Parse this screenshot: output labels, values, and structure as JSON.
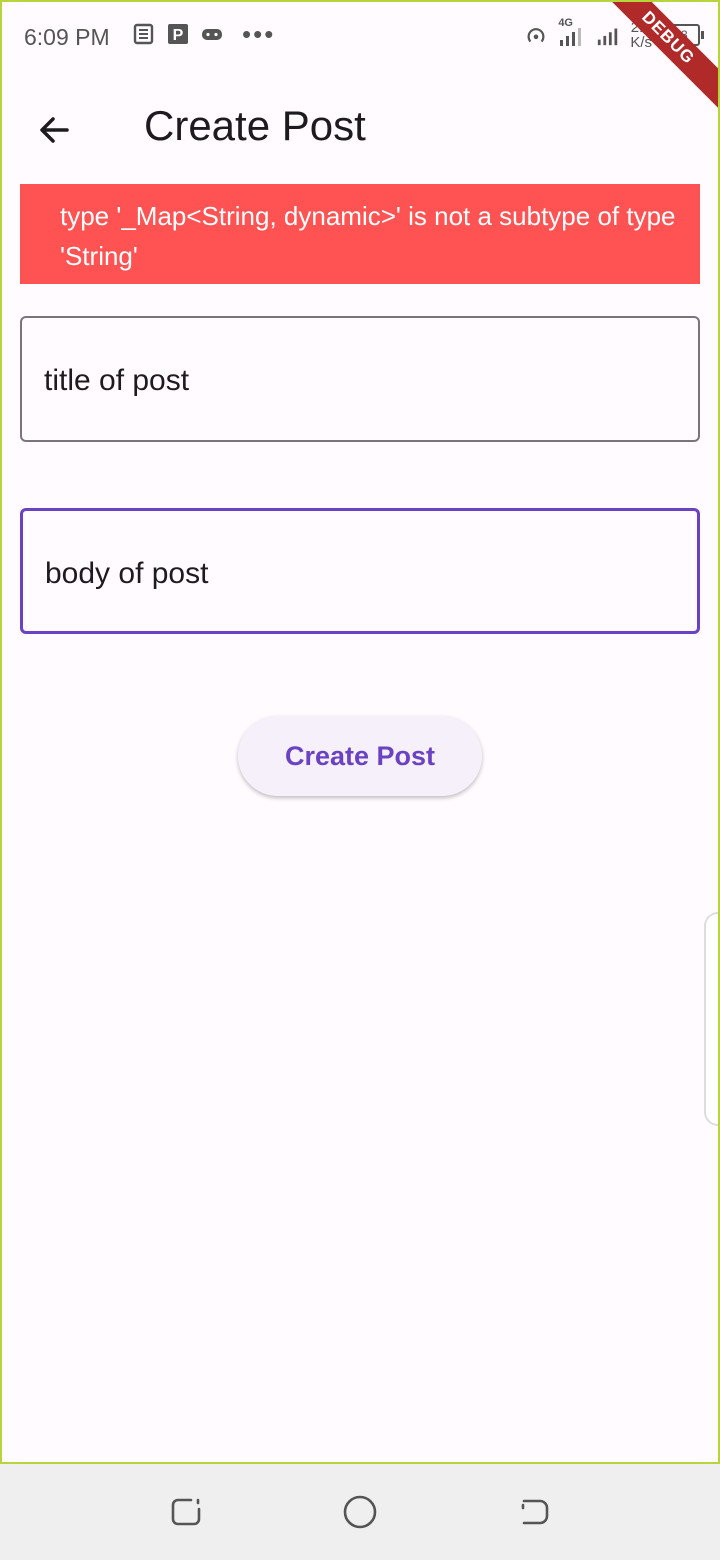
{
  "status_bar": {
    "time": "6:09 PM",
    "network_label": "4G",
    "speed_value": "2.7",
    "speed_unit": "K/s",
    "battery": "73",
    "debug_banner": "DEBUG"
  },
  "app_bar": {
    "title": "Create Post",
    "back_icon": "arrow-back-icon"
  },
  "error_message": "type '_Map<String, dynamic>' is not a subtype of type 'String'",
  "form": {
    "title_value": "title of post",
    "body_value": "body of post",
    "submit_label": "Create Post"
  },
  "colors": {
    "error_bg": "#ff5252",
    "accent": "#6a42c2",
    "button_bg": "#f5f0fa",
    "background": "#fffbfe",
    "debug_ribbon": "#b02a2a"
  },
  "nav_bar": {
    "recent_icon": "recent-apps-icon",
    "home_icon": "home-circle-icon",
    "back_icon": "nav-back-icon"
  }
}
